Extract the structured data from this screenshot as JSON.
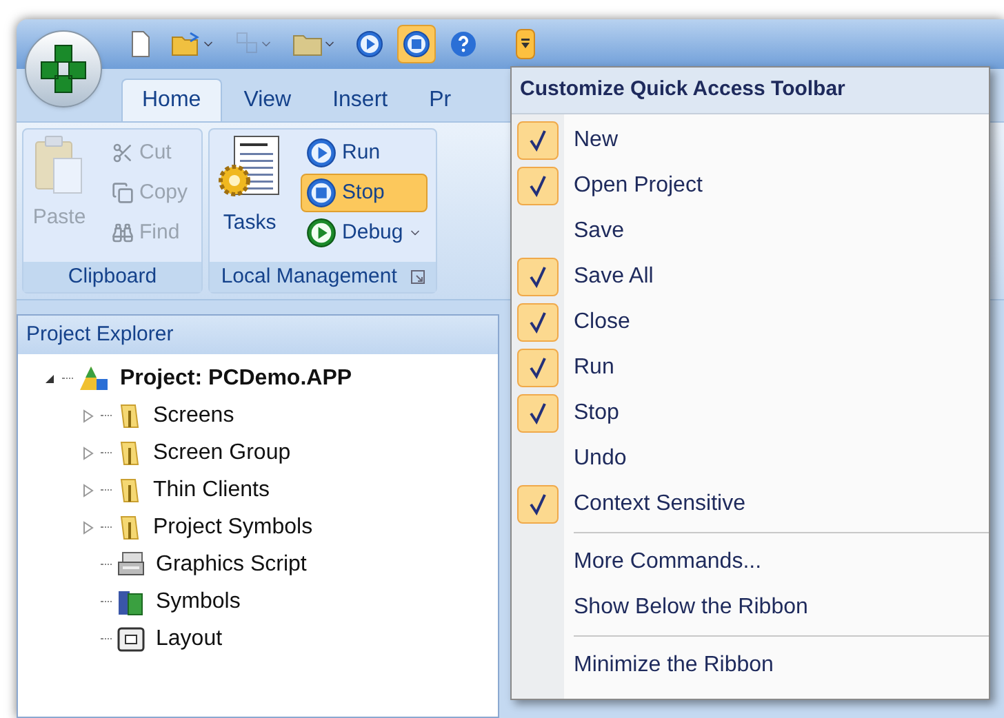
{
  "quick_access": [
    {
      "kind": "new",
      "dropdown": false,
      "disabled": false,
      "highlighted": false
    },
    {
      "kind": "open",
      "dropdown": true,
      "disabled": false,
      "highlighted": false
    },
    {
      "kind": "grid",
      "dropdown": true,
      "disabled": true,
      "highlighted": false
    },
    {
      "kind": "folder",
      "dropdown": true,
      "disabled": false,
      "highlighted": false
    },
    {
      "kind": "run",
      "dropdown": false,
      "disabled": false,
      "highlighted": false
    },
    {
      "kind": "stop",
      "dropdown": false,
      "disabled": false,
      "highlighted": true
    },
    {
      "kind": "help",
      "dropdown": false,
      "disabled": false,
      "highlighted": false
    }
  ],
  "customize_button": {
    "open": true
  },
  "tabs": [
    {
      "label": "Home",
      "selected": true
    },
    {
      "label": "View",
      "selected": false
    },
    {
      "label": "Insert",
      "selected": false
    },
    {
      "label": "Pr",
      "selected": false
    }
  ],
  "ribbon_groups": [
    {
      "title": "Clipboard",
      "disabled": true,
      "launcher": false,
      "large": {
        "label": "Paste",
        "kind": "paste"
      },
      "small": [
        {
          "label": "Cut",
          "kind": "cut",
          "highlighted": false,
          "dropdown": false
        },
        {
          "label": "Copy",
          "kind": "copy",
          "highlighted": false,
          "dropdown": false
        },
        {
          "label": "Find",
          "kind": "find",
          "highlighted": false,
          "dropdown": false
        }
      ]
    },
    {
      "title": "Local Management",
      "disabled": false,
      "launcher": true,
      "large": {
        "label": "Tasks",
        "kind": "tasks"
      },
      "small": [
        {
          "label": "Run",
          "kind": "run",
          "highlighted": false,
          "dropdown": false
        },
        {
          "label": "Stop",
          "kind": "stop",
          "highlighted": true,
          "dropdown": false
        },
        {
          "label": "Debug",
          "kind": "debug",
          "highlighted": false,
          "dropdown": true
        }
      ]
    }
  ],
  "project_explorer": {
    "title": "Project Explorer",
    "tree": {
      "label": "Project: PCDemo.APP",
      "kind": "project",
      "expanded": true,
      "children": [
        {
          "label": "Screens",
          "kind": "folder",
          "expanded": false
        },
        {
          "label": "Screen Group",
          "kind": "folder",
          "expanded": false
        },
        {
          "label": "Thin Clients",
          "kind": "folder",
          "expanded": false
        },
        {
          "label": "Project Symbols",
          "kind": "folder",
          "expanded": false
        },
        {
          "label": "Graphics Script",
          "kind": "script"
        },
        {
          "label": "Symbols",
          "kind": "symbols"
        },
        {
          "label": "Layout",
          "kind": "layout"
        }
      ]
    }
  },
  "menu": {
    "title": "Customize Quick Access Toolbar",
    "sections": [
      [
        {
          "label": "New",
          "checked": true
        },
        {
          "label": "Open Project",
          "checked": true
        },
        {
          "label": "Save",
          "checked": false
        },
        {
          "label": "Save All",
          "checked": true
        },
        {
          "label": "Close",
          "checked": true
        },
        {
          "label": "Run",
          "checked": true
        },
        {
          "label": "Stop",
          "checked": true
        },
        {
          "label": "Undo",
          "checked": false
        },
        {
          "label": "Context Sensitive",
          "checked": true
        }
      ],
      [
        {
          "label": "More Commands..."
        },
        {
          "label": "Show Below the Ribbon"
        }
      ],
      [
        {
          "label": "Minimize the Ribbon"
        }
      ]
    ]
  }
}
